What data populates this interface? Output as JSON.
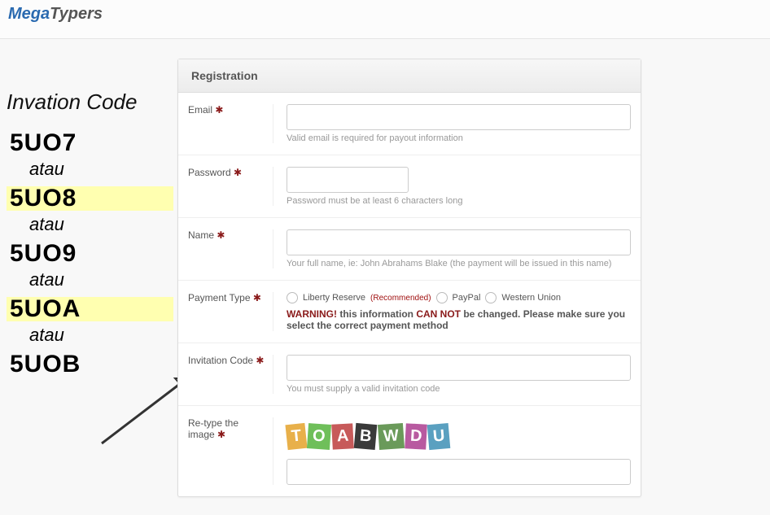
{
  "logo": {
    "part1": "Mega",
    "part2": "Typers"
  },
  "left": {
    "title": "Invation Code",
    "codes": [
      "5UO7",
      "5UO8",
      "5UO9",
      "5UOA",
      "5UOB"
    ],
    "separator": "atau"
  },
  "form": {
    "header": "Registration",
    "email": {
      "label": "Email",
      "hint": "Valid email is required for payout information"
    },
    "password": {
      "label": "Password",
      "hint": "Password must be at least 6 characters long"
    },
    "name": {
      "label": "Name",
      "hint": "Your full name, ie: John Abrahams Blake (the payment will be issued in this name)"
    },
    "payment": {
      "label": "Payment Type",
      "opt1": "Liberty Reserve",
      "recommended": "(Recommended)",
      "opt2": "PayPal",
      "opt3": "Western Union",
      "warn_word": "WARNING!",
      "warn_text1": " this information ",
      "cannot": "CAN NOT",
      "warn_text2": " be changed. Please make sure you select the correct payment method"
    },
    "invitation": {
      "label": "Invitation Code",
      "hint": "You must supply a valid invitation code"
    },
    "retype": {
      "label": "Re-type the image"
    },
    "captcha": [
      "T",
      "O",
      "A",
      "B",
      "W",
      "D",
      "U"
    ]
  }
}
